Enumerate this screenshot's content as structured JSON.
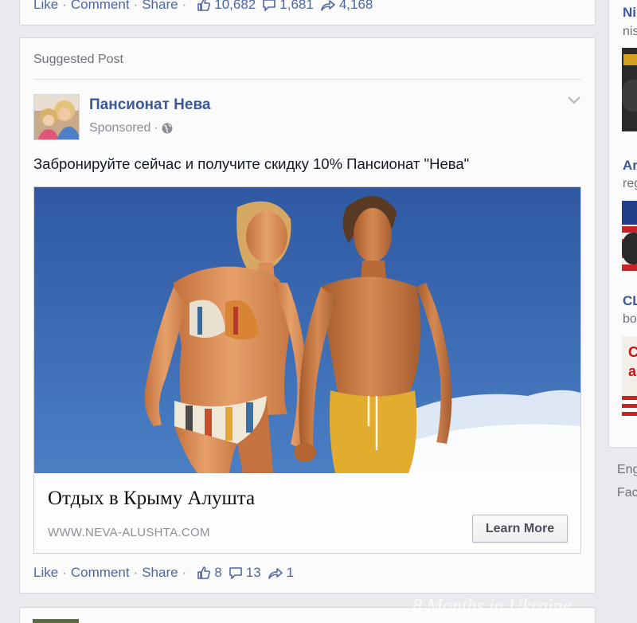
{
  "top_post": {
    "like_label": "Like",
    "comment_label": "Comment",
    "share_label": "Share",
    "sep": "·",
    "likes": "10,682",
    "comments": "1,681",
    "shares": "4,168"
  },
  "ad": {
    "header": "Suggested Post",
    "page_name": "Пансионат Нева",
    "sponsored": "Sponsored",
    "sep": "·",
    "text": "Забронируйте сейчас и получите скидку 10% Пансионат \"Нева\"",
    "headline": "Отдых в Крыму Алушта",
    "domain": "WWW.NEVA-ALUSHTA.COM",
    "cta_label": "Learn More",
    "like_label": "Like",
    "comment_label": "Comment",
    "share_label": "Share",
    "likes": "8",
    "comments": "13",
    "shares": "1"
  },
  "right_column": {
    "items": [
      {
        "title": "Ni",
        "sub": "nis"
      },
      {
        "title": "Ar",
        "sub": "reg"
      },
      {
        "title": "CL",
        "sub": "bo"
      }
    ],
    "footer": [
      "Eng",
      "Fac"
    ]
  },
  "watermark": "8 Months in Ukraine",
  "colors": {
    "link": "#4e67a3",
    "page_name": "#3b5998",
    "background": "#e9eaed",
    "card": "#fbfbfb"
  }
}
